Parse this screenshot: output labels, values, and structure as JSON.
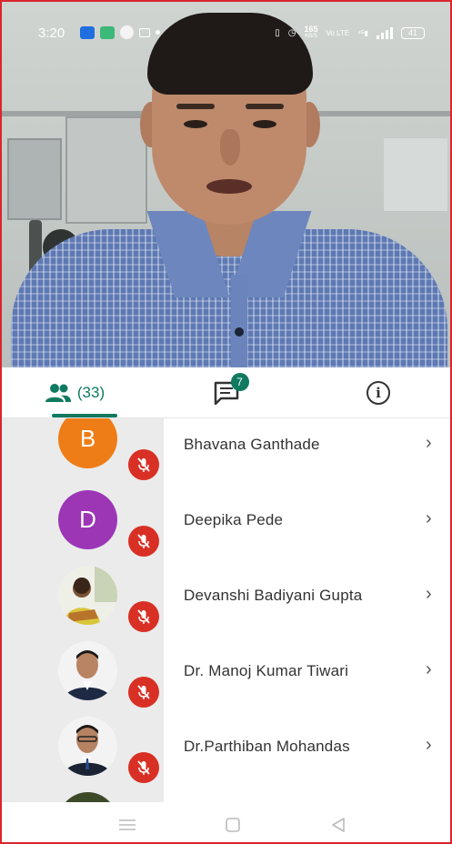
{
  "status_bar": {
    "time": "3:20",
    "network_speed": "165",
    "speed_unit": "KB/S",
    "battery": "41"
  },
  "tabs": {
    "people_count": "(33)",
    "chat_badge": "7"
  },
  "participants": [
    {
      "name": "Bhavana Ganthade",
      "initial": "B",
      "avatar_color": "#ef7d17",
      "muted": true
    },
    {
      "name": "Deepika Pede",
      "initial": "D",
      "avatar_color": "#9c36b5",
      "muted": true
    },
    {
      "name": "Devanshi Badiyani Gupta",
      "initial": "",
      "avatar": "photo",
      "muted": true
    },
    {
      "name": "Dr. Manoj Kumar Tiwari",
      "initial": "",
      "avatar": "photo",
      "muted": true
    },
    {
      "name": "Dr.Parthiban Mohandas",
      "initial": "",
      "avatar": "photo",
      "muted": true
    }
  ],
  "colors": {
    "accent": "#0f7a60",
    "mute_red": "#d93025",
    "frame_red": "#d9262b"
  }
}
